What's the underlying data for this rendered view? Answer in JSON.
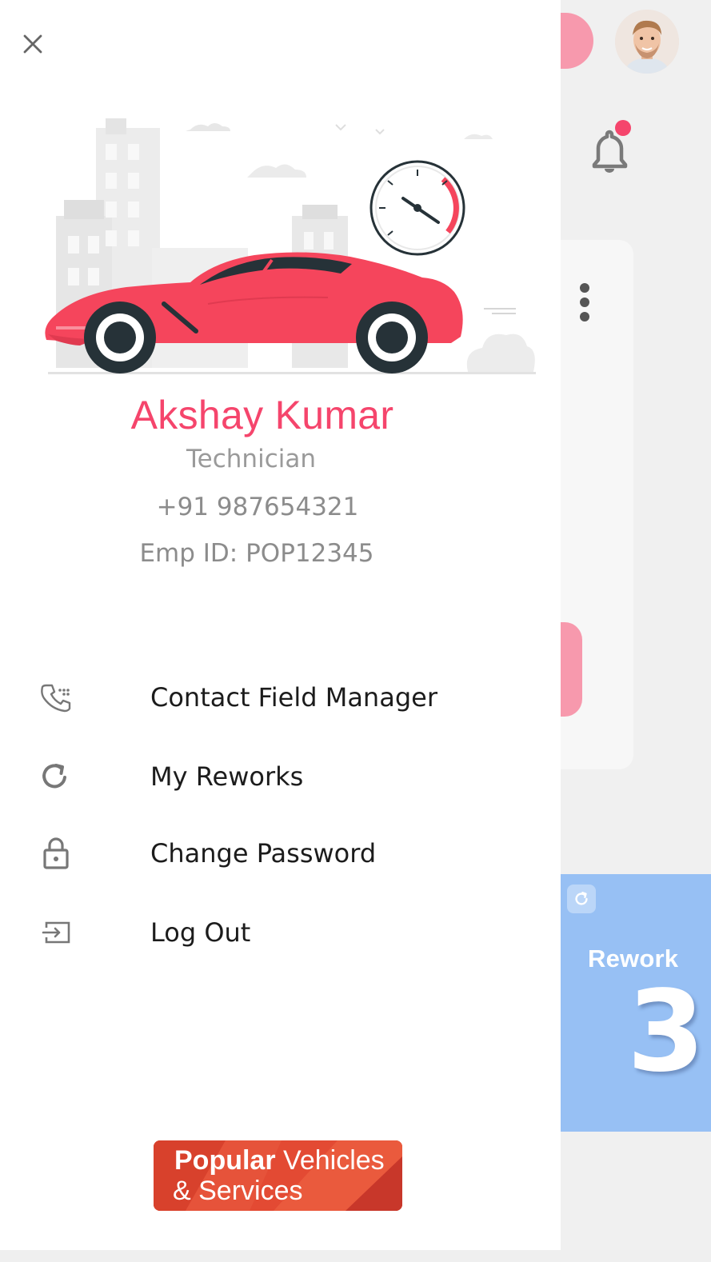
{
  "drawer": {
    "close_icon": "close-icon",
    "profile": {
      "name": "Akshay Kumar",
      "role": "Technician",
      "phone": "+91 987654321",
      "emp_id": "Emp ID: POP12345"
    },
    "menu": [
      {
        "label": "Contact Field Manager",
        "icon": "phone-icon"
      },
      {
        "label": "My Reworks",
        "icon": "refresh-icon"
      },
      {
        "label": "Change Password",
        "icon": "lock-icon"
      },
      {
        "label": "Log Out",
        "icon": "logout-icon"
      }
    ],
    "brand": {
      "word1": "Popular",
      "word2": "Vehicles",
      "word3": "& Services"
    }
  },
  "background": {
    "rework_card": {
      "label": "Rework",
      "count": "3"
    },
    "notification_dot": true
  },
  "colors": {
    "accent_pink": "#f5456c",
    "rework_blue": "#97c0f4",
    "brand_red": "#e0442f"
  }
}
